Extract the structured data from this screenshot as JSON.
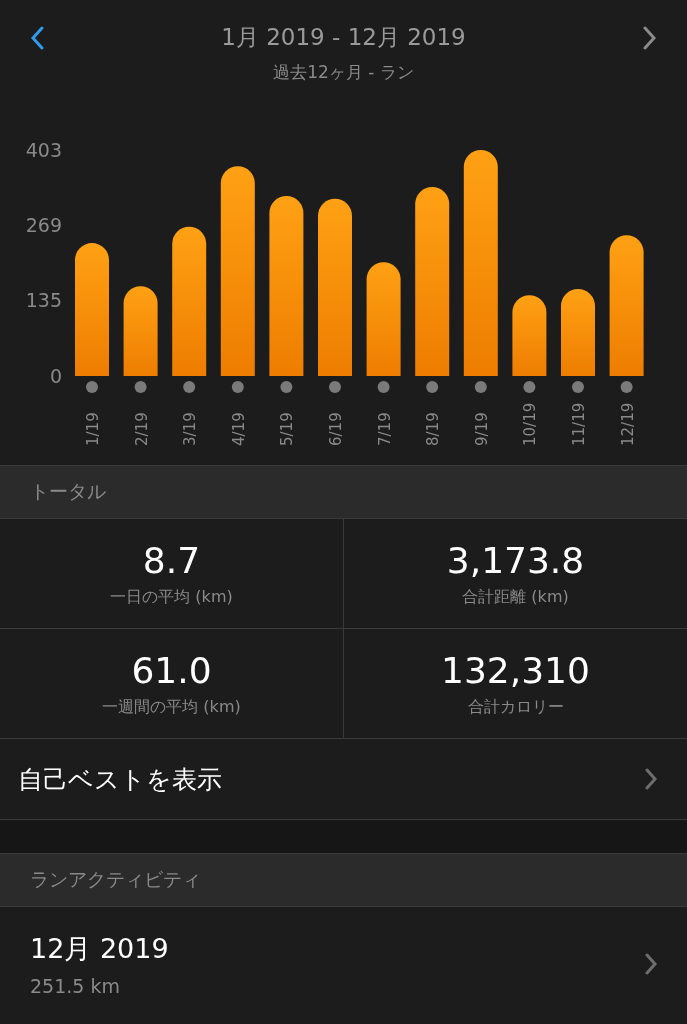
{
  "header": {
    "title": "1月 2019 - 12月 2019",
    "subtitle": "過去12ヶ月 - ラン"
  },
  "chart_data": {
    "type": "bar",
    "categories": [
      "1/19",
      "2/19",
      "3/19",
      "4/19",
      "5/19",
      "6/19",
      "7/19",
      "8/19",
      "9/19",
      "10/19",
      "11/19",
      "12/19"
    ],
    "values": [
      237,
      160,
      266,
      374,
      321,
      316,
      203,
      337,
      403,
      144,
      155,
      251
    ],
    "ylim": [
      0,
      403
    ],
    "yticks": [
      0,
      135,
      269,
      403
    ]
  },
  "totals": {
    "heading": "トータル",
    "stats": [
      {
        "value": "8.7",
        "label": "一日の平均 (km)"
      },
      {
        "value": "3,173.8",
        "label": "合計距離 (km)"
      },
      {
        "value": "61.0",
        "label": "一週間の平均 (km)"
      },
      {
        "value": "132,310",
        "label": "合計カロリー"
      }
    ]
  },
  "personal_best": {
    "label": "自己ベストを表示"
  },
  "activities": {
    "heading": "ランアクティビティ",
    "items": [
      {
        "title": "12月 2019",
        "distance": "251.5 km"
      }
    ]
  }
}
